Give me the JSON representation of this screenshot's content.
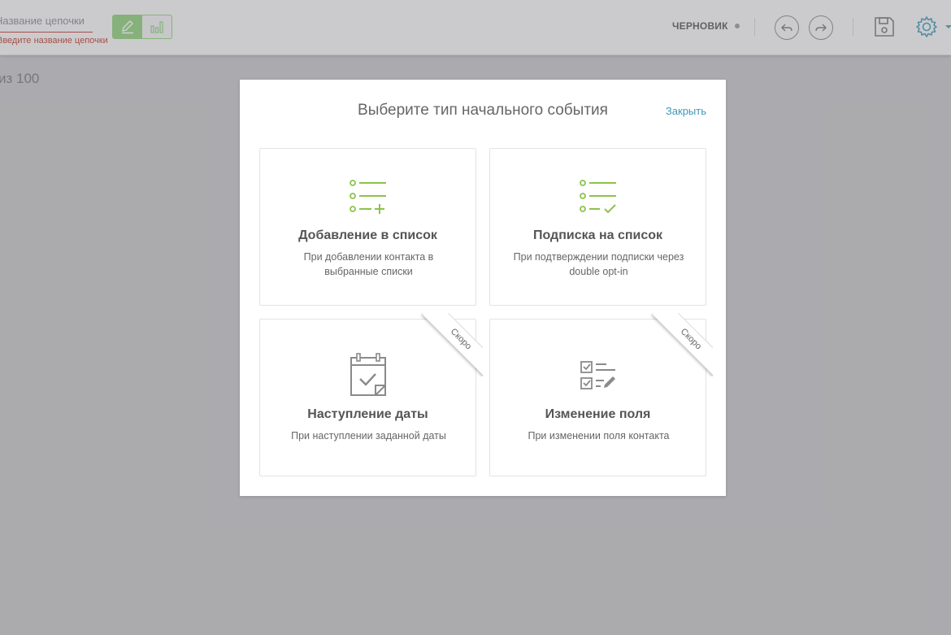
{
  "topbar": {
    "chain_name_placeholder": "Название цепочки",
    "chain_name_error": "Введите название цепочки",
    "status_label": "ЧЕРНОВИК",
    "icons": {
      "edit": "pencil-icon",
      "stats": "bar-chart-icon",
      "undo": "undo-icon",
      "redo": "redo-icon",
      "save": "floppy-disk-icon",
      "settings": "gear-icon"
    }
  },
  "counter_text": "из 100",
  "modal": {
    "title": "Выберите тип начального события",
    "close_label": "Закрыть",
    "cards": [
      {
        "title": "Добавление в список",
        "desc": "При добавлении контакта в выбранные списки",
        "icon": "list-add-icon"
      },
      {
        "title": "Подписка на список",
        "desc": "При подтверждении подписки через double opt-in",
        "icon": "list-check-icon"
      },
      {
        "title": "Наступление даты",
        "desc": "При наступлении заданной даты",
        "icon": "calendar-check-icon",
        "badge": "Скоро"
      },
      {
        "title": "Изменение поля",
        "desc": "При изменении поля контакта",
        "icon": "checklist-edit-icon",
        "badge": "Скоро"
      }
    ]
  },
  "colors": {
    "accent_green": "#8bc34a",
    "link_blue": "#3d98b8",
    "error_red": "#c0392b",
    "disabled_gray": "#8a8a8a"
  }
}
